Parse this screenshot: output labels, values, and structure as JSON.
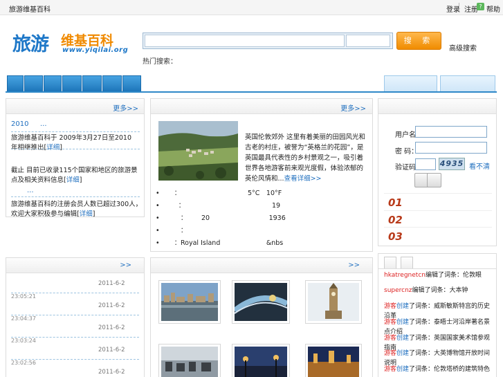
{
  "topbar": {
    "left": "旅游维基百科",
    "login": "登录",
    "register": "注册",
    "help": "帮助",
    "help_glyph": "?"
  },
  "logo": {
    "cn1": "旅游",
    "cn2": "维基百科",
    "url": "www.yiqilai.org"
  },
  "search": {
    "placeholder": "",
    "button": "搜 索",
    "advanced": "高级搜索",
    "hot": "热门搜索："
  },
  "news": {
    "more": "更多>>",
    "headline_year": "2010",
    "headline_dots": "...",
    "items": [
      {
        "text": "旅游维基百科于 2009年3月27日至2010年相继推出",
        "link": "详细"
      },
      {
        "text": "截止 目前已收录115个国家和地区的旅游景点及相关资料信息",
        "link": "详细"
      },
      {
        "text": "...",
        "link": ""
      },
      {
        "text": "旅游维基百科的注册会员人数已超过300人，欢迎大家积极参与编辑",
        "link": "详细"
      }
    ]
  },
  "feature": {
    "more": "更多>>",
    "desc": "英国伦敦郊外 这里有着美丽的田园风光和古老的村庄，被誉为“英格兰的花园”，是英国最具代表性的乡村景观之一，吸引着世界各地游客前来观光度假，体验浓郁的英伦风情和...",
    "desc_link": "查看详细>>",
    "facts": [
      {
        "k": "：",
        "v": "5°C　10°F"
      },
      {
        "k": "：",
        "v": "19"
      },
      {
        "k": "：",
        "v": "20　　　　　　　　　1936"
      },
      {
        "k": "：",
        "v": ""
      },
      {
        "k": "：",
        "v": "Royal Island　　　　　　　&nbs"
      }
    ]
  },
  "login": {
    "user_label": "用户名：",
    "pass_label": "密  码：",
    "code_label": "验证码：",
    "captcha": "4935",
    "captcha_refresh": "看不清",
    "ranks": [
      "01",
      "02",
      "03"
    ]
  },
  "updates": {
    "more": ">>",
    "rows": [
      {
        "date": "2011-6-2",
        "time": "23:05:21"
      },
      {
        "date": "2011-6-2",
        "time": "23:04:37"
      },
      {
        "date": "2011-6-2",
        "time": "23:03:24"
      },
      {
        "date": "2011-6-2",
        "time": "23:02:56"
      },
      {
        "date": "2011-6-2",
        "time": ""
      }
    ]
  },
  "gallery": {
    "more": ">>"
  },
  "activity": {
    "rows": [
      {
        "user": "hkatregnetcn",
        "text": "编辑了词条：伦敦眼"
      },
      {
        "user": "supercnz",
        "text": "编辑了词条：大本钟"
      },
      {
        "user": "游客",
        "mid": "创建",
        "text": "了词条：威斯敏斯特宫的历史沿革"
      },
      {
        "user": "游客",
        "mid": "创建",
        "text": "了词条：泰晤士河沿岸著名景点介绍"
      },
      {
        "user": "游客",
        "mid": "创建",
        "text": "了词条：英国国家美术馆参观指南"
      },
      {
        "user": "游客",
        "mid": "创建",
        "text": "了词条：大英博物馆开放时间说明"
      },
      {
        "user": "游客",
        "mid": "创建",
        "text": "了词条：伦敦塔桥的建筑特色"
      }
    ]
  },
  "colors": {
    "accent": "#1f78c8",
    "orange": "#f08a00",
    "nav": "#2e88c8"
  }
}
